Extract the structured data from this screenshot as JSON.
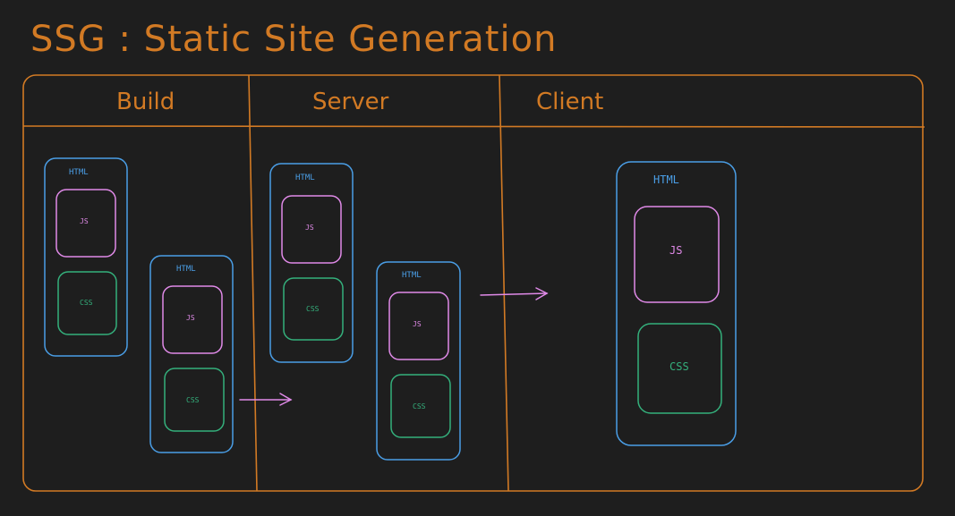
{
  "title": "SSG : Static Site Generation",
  "columns": {
    "build": "Build",
    "server": "Server",
    "client": "Client"
  },
  "labels": {
    "html": "HTML",
    "js": "JS",
    "css": "CSS"
  },
  "colors": {
    "background": "#1e1e1e",
    "frame": "#d27a24",
    "html": "#4a9ee6",
    "js": "#e08ae8",
    "css": "#34b07c"
  }
}
